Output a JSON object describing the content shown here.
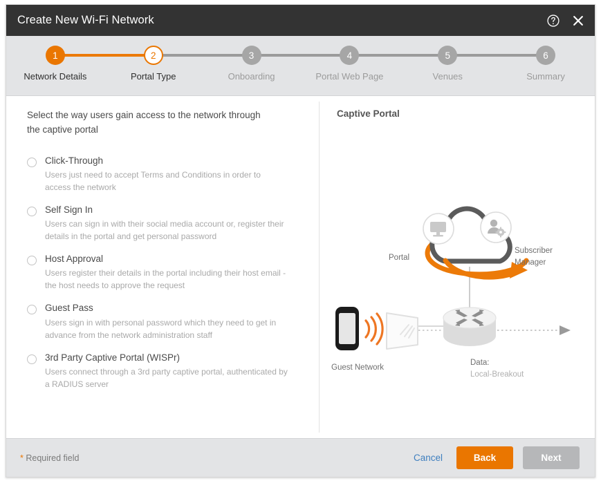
{
  "window": {
    "title": "Create New Wi-Fi Network",
    "help_icon": "help-circle-icon",
    "close_icon": "close-icon",
    "titlebar_color": "#333333",
    "accent_color": "#ea7600"
  },
  "stepper": {
    "steps": [
      {
        "number": "1",
        "label": "Network Details",
        "state": "done"
      },
      {
        "number": "2",
        "label": "Portal Type",
        "state": "current"
      },
      {
        "number": "3",
        "label": "Onboarding",
        "state": "todo"
      },
      {
        "number": "4",
        "label": "Portal Web Page",
        "state": "todo"
      },
      {
        "number": "5",
        "label": "Venues",
        "state": "todo"
      },
      {
        "number": "6",
        "label": "Summary",
        "state": "todo"
      }
    ]
  },
  "left": {
    "prompt": "Select the way users gain access to the network through the captive portal",
    "options": [
      {
        "label": "Click-Through",
        "description": "Users just need to accept Terms and Conditions in order to access the network",
        "selected": false
      },
      {
        "label": "Self Sign In",
        "description": "Users can sign in with their social media account or, register their details in the portal and get personal password",
        "selected": false
      },
      {
        "label": "Host Approval",
        "description": "Users register their details in the portal including their host email - the host needs to approve the request",
        "selected": false
      },
      {
        "label": "Guest Pass",
        "description": "Users sign in with personal password which they need to get in advance from the network administration staff",
        "selected": false
      },
      {
        "label": "3rd Party Captive Portal (WISPr)",
        "description": "Users connect through a 3rd party captive portal, authenticated by a RADIUS server",
        "selected": false
      }
    ]
  },
  "right": {
    "title": "Captive Portal",
    "diagram": {
      "portal_label": "Portal",
      "subscriber_label_line1": "Subscriber",
      "subscriber_label_line2": "Manager",
      "guest_network_label": "Guest Network",
      "data_label_line1": "Data:",
      "data_label_line2": "Local-Breakout",
      "icons": [
        "monitor-icon",
        "user-gear-icon",
        "cloud-icon",
        "smartphone-icon",
        "wifi-waves-icon",
        "access-point-icon",
        "router-icon",
        "arrow-right-icon"
      ]
    }
  },
  "footer": {
    "required_star": "*",
    "required_text": "Required field",
    "cancel_label": "Cancel",
    "back_label": "Back",
    "next_label": "Next"
  }
}
